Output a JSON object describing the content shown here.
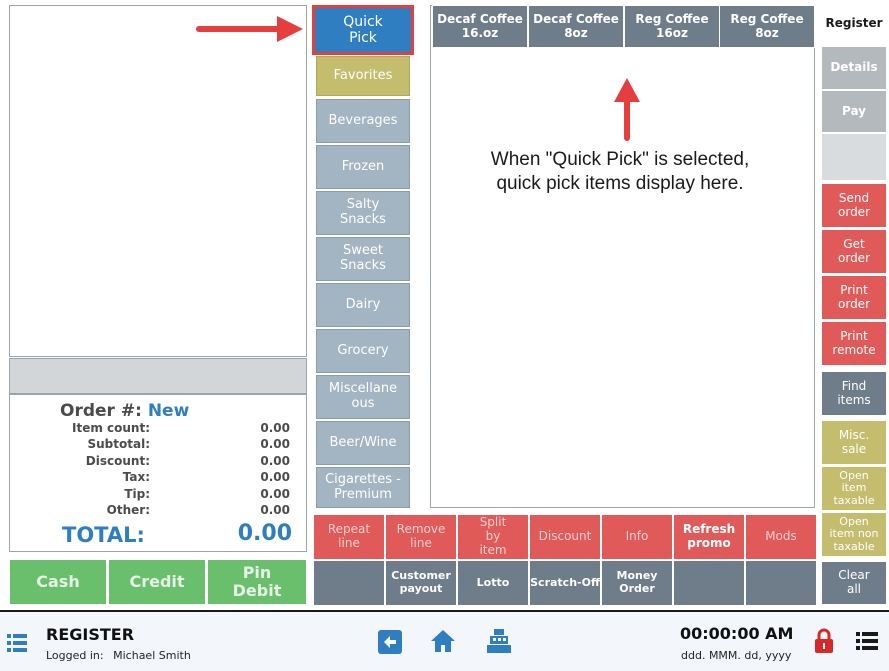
{
  "order": {
    "label": "Order #:",
    "number": "New",
    "rows": [
      {
        "label": "Item count:",
        "value": "0.00"
      },
      {
        "label": "Subtotal:",
        "value": "0.00"
      },
      {
        "label": "Discount:",
        "value": "0.00"
      },
      {
        "label": "Tax:",
        "value": "0.00"
      },
      {
        "label": "Tip:",
        "value": "0.00"
      },
      {
        "label": "Other:",
        "value": "0.00"
      }
    ],
    "total_label": "TOTAL:",
    "total_value": "0.00"
  },
  "payment": {
    "cash": "Cash",
    "credit": "Credit",
    "pin_debit": "Pin Debit"
  },
  "categories": {
    "quick_pick": "Quick Pick",
    "favorites": "Favorites",
    "beverages": "Beverages",
    "frozen": "Frozen",
    "salty_snacks": "Salty Snacks",
    "sweet_snacks": "Sweet Snacks",
    "dairy": "Dairy",
    "grocery": "Grocery",
    "miscellaneous": "Miscellane ous",
    "beer_wine": "Beer/Wine",
    "cigarettes_premium": "Cigarettes - Premium"
  },
  "items": [
    {
      "label": "Decaf Coffee 16.oz"
    },
    {
      "label": "Decaf Coffee 8oz"
    },
    {
      "label": "Reg Coffee 16oz"
    },
    {
      "label": "Reg Coffee 8oz"
    }
  ],
  "annotation": "When \"Quick Pick\" is selected, quick pick items display here.",
  "actions_row1": {
    "repeat_line": "Repeat line",
    "remove_line": "Remove line",
    "split_by_item": "Split by item",
    "discount": "Discount",
    "info": "Info",
    "refresh_promo": "Refresh promo",
    "mods": "Mods"
  },
  "actions_row2": {
    "customer_payout": "Customer payout",
    "lotto": "Lotto",
    "scratch_off": "Scratch-Off",
    "money_order": "Money Order"
  },
  "side": {
    "register": "Register",
    "details": "Details",
    "pay": "Pay",
    "send_order": "Send order",
    "get_order": "Get order",
    "print_order": "Print order",
    "print_remote": "Print remote",
    "find_items": "Find items",
    "misc_sale": "Misc. sale",
    "open_item_taxable": "Open item taxable",
    "open_item_non_taxable": "Open item non taxable",
    "clear_all": "Clear all"
  },
  "bottom_bar": {
    "title": "REGISTER",
    "logged_in_label": "Logged in:",
    "user": "Michael Smith",
    "time": "00:00:00 AM",
    "date": "ddd. MMM. dd, yyyy"
  },
  "colors": {
    "accent_blue": "#2f7ec2",
    "action_red": "#e05a5a",
    "highlight_red": "#e53e3e",
    "category_slate": "#a3b4c2",
    "olive": "#c4bd6e",
    "green": "#6abf6d",
    "item_gray": "#6f7d8a"
  },
  "icons": [
    "menu-icon",
    "back-arrow-icon",
    "home-icon",
    "cash-register-icon",
    "lock-icon",
    "list-menu-icon",
    "arrow-icon"
  ]
}
